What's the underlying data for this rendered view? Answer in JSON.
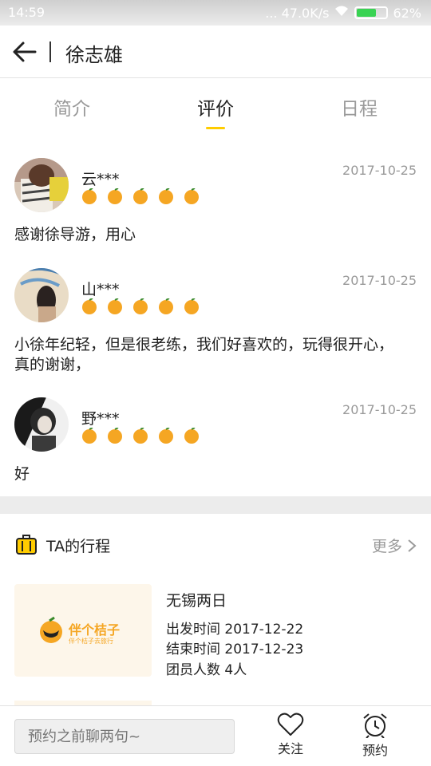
{
  "status": {
    "time": "14:59",
    "network": "... 47.0K/s",
    "battery": "62%"
  },
  "header": {
    "title": "徐志雄"
  },
  "tabs": [
    {
      "label": "简介"
    },
    {
      "label": "评价"
    },
    {
      "label": "日程"
    }
  ],
  "reviews": [
    {
      "name": "云***",
      "date": "2017-10-25",
      "rating": 5,
      "text": "感谢徐导游，用心"
    },
    {
      "name": "山***",
      "date": "2017-10-25",
      "rating": 5,
      "text": "小徐年纪轻，但是很老练，我们好喜欢的，玩得很开心，真的谢谢，"
    },
    {
      "name": "野***",
      "date": "2017-10-25",
      "rating": 5,
      "text": "好"
    }
  ],
  "itinerary": {
    "title": "TA的行程",
    "more": "更多",
    "logo_text": "伴个桔子",
    "logo_sub": "伴个桔子去旅行",
    "trip": {
      "name": "无锡两日",
      "start": "出发时间 2017-12-22",
      "end": "结束时间 2017-12-23",
      "members": "团员人数 4人"
    }
  },
  "bottom": {
    "placeholder": "预约之前聊两句~",
    "follow": "关注",
    "book": "预约"
  },
  "colors": {
    "accent": "#ffcc00",
    "orange": "#f5a623",
    "muted": "#9a9a9a"
  }
}
